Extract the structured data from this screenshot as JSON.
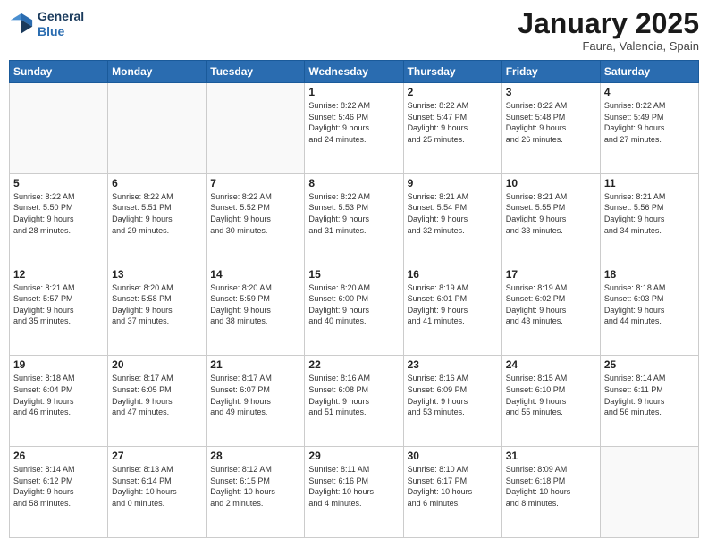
{
  "header": {
    "logo_line1": "General",
    "logo_line2": "Blue",
    "month": "January 2025",
    "location": "Faura, Valencia, Spain"
  },
  "days_of_week": [
    "Sunday",
    "Monday",
    "Tuesday",
    "Wednesday",
    "Thursday",
    "Friday",
    "Saturday"
  ],
  "weeks": [
    [
      {
        "day": "",
        "info": ""
      },
      {
        "day": "",
        "info": ""
      },
      {
        "day": "",
        "info": ""
      },
      {
        "day": "1",
        "info": "Sunrise: 8:22 AM\nSunset: 5:46 PM\nDaylight: 9 hours\nand 24 minutes."
      },
      {
        "day": "2",
        "info": "Sunrise: 8:22 AM\nSunset: 5:47 PM\nDaylight: 9 hours\nand 25 minutes."
      },
      {
        "day": "3",
        "info": "Sunrise: 8:22 AM\nSunset: 5:48 PM\nDaylight: 9 hours\nand 26 minutes."
      },
      {
        "day": "4",
        "info": "Sunrise: 8:22 AM\nSunset: 5:49 PM\nDaylight: 9 hours\nand 27 minutes."
      }
    ],
    [
      {
        "day": "5",
        "info": "Sunrise: 8:22 AM\nSunset: 5:50 PM\nDaylight: 9 hours\nand 28 minutes."
      },
      {
        "day": "6",
        "info": "Sunrise: 8:22 AM\nSunset: 5:51 PM\nDaylight: 9 hours\nand 29 minutes."
      },
      {
        "day": "7",
        "info": "Sunrise: 8:22 AM\nSunset: 5:52 PM\nDaylight: 9 hours\nand 30 minutes."
      },
      {
        "day": "8",
        "info": "Sunrise: 8:22 AM\nSunset: 5:53 PM\nDaylight: 9 hours\nand 31 minutes."
      },
      {
        "day": "9",
        "info": "Sunrise: 8:21 AM\nSunset: 5:54 PM\nDaylight: 9 hours\nand 32 minutes."
      },
      {
        "day": "10",
        "info": "Sunrise: 8:21 AM\nSunset: 5:55 PM\nDaylight: 9 hours\nand 33 minutes."
      },
      {
        "day": "11",
        "info": "Sunrise: 8:21 AM\nSunset: 5:56 PM\nDaylight: 9 hours\nand 34 minutes."
      }
    ],
    [
      {
        "day": "12",
        "info": "Sunrise: 8:21 AM\nSunset: 5:57 PM\nDaylight: 9 hours\nand 35 minutes."
      },
      {
        "day": "13",
        "info": "Sunrise: 8:20 AM\nSunset: 5:58 PM\nDaylight: 9 hours\nand 37 minutes."
      },
      {
        "day": "14",
        "info": "Sunrise: 8:20 AM\nSunset: 5:59 PM\nDaylight: 9 hours\nand 38 minutes."
      },
      {
        "day": "15",
        "info": "Sunrise: 8:20 AM\nSunset: 6:00 PM\nDaylight: 9 hours\nand 40 minutes."
      },
      {
        "day": "16",
        "info": "Sunrise: 8:19 AM\nSunset: 6:01 PM\nDaylight: 9 hours\nand 41 minutes."
      },
      {
        "day": "17",
        "info": "Sunrise: 8:19 AM\nSunset: 6:02 PM\nDaylight: 9 hours\nand 43 minutes."
      },
      {
        "day": "18",
        "info": "Sunrise: 8:18 AM\nSunset: 6:03 PM\nDaylight: 9 hours\nand 44 minutes."
      }
    ],
    [
      {
        "day": "19",
        "info": "Sunrise: 8:18 AM\nSunset: 6:04 PM\nDaylight: 9 hours\nand 46 minutes."
      },
      {
        "day": "20",
        "info": "Sunrise: 8:17 AM\nSunset: 6:05 PM\nDaylight: 9 hours\nand 47 minutes."
      },
      {
        "day": "21",
        "info": "Sunrise: 8:17 AM\nSunset: 6:07 PM\nDaylight: 9 hours\nand 49 minutes."
      },
      {
        "day": "22",
        "info": "Sunrise: 8:16 AM\nSunset: 6:08 PM\nDaylight: 9 hours\nand 51 minutes."
      },
      {
        "day": "23",
        "info": "Sunrise: 8:16 AM\nSunset: 6:09 PM\nDaylight: 9 hours\nand 53 minutes."
      },
      {
        "day": "24",
        "info": "Sunrise: 8:15 AM\nSunset: 6:10 PM\nDaylight: 9 hours\nand 55 minutes."
      },
      {
        "day": "25",
        "info": "Sunrise: 8:14 AM\nSunset: 6:11 PM\nDaylight: 9 hours\nand 56 minutes."
      }
    ],
    [
      {
        "day": "26",
        "info": "Sunrise: 8:14 AM\nSunset: 6:12 PM\nDaylight: 9 hours\nand 58 minutes."
      },
      {
        "day": "27",
        "info": "Sunrise: 8:13 AM\nSunset: 6:14 PM\nDaylight: 10 hours\nand 0 minutes."
      },
      {
        "day": "28",
        "info": "Sunrise: 8:12 AM\nSunset: 6:15 PM\nDaylight: 10 hours\nand 2 minutes."
      },
      {
        "day": "29",
        "info": "Sunrise: 8:11 AM\nSunset: 6:16 PM\nDaylight: 10 hours\nand 4 minutes."
      },
      {
        "day": "30",
        "info": "Sunrise: 8:10 AM\nSunset: 6:17 PM\nDaylight: 10 hours\nand 6 minutes."
      },
      {
        "day": "31",
        "info": "Sunrise: 8:09 AM\nSunset: 6:18 PM\nDaylight: 10 hours\nand 8 minutes."
      },
      {
        "day": "",
        "info": ""
      }
    ]
  ]
}
